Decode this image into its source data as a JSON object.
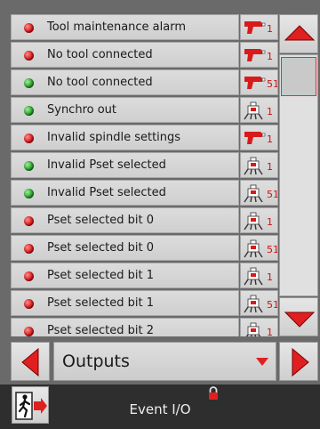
{
  "list": {
    "items": [
      {
        "label": "Tool maintenance alarm",
        "led": "red",
        "icon": "spindle-icon",
        "num": "1"
      },
      {
        "label": "No tool connected",
        "led": "red",
        "icon": "spindle-icon",
        "num": "1"
      },
      {
        "label": "No tool connected",
        "led": "green",
        "icon": "spindle-icon",
        "num": "51"
      },
      {
        "label": "Synchro out",
        "led": "green",
        "icon": "controller-icon",
        "num": "1"
      },
      {
        "label": "Invalid spindle settings",
        "led": "red",
        "icon": "spindle-icon",
        "num": "1"
      },
      {
        "label": "Invalid Pset selected",
        "led": "green",
        "icon": "controller-icon",
        "num": "1"
      },
      {
        "label": "Invalid Pset selected",
        "led": "green",
        "icon": "controller-icon",
        "num": "51"
      },
      {
        "label": "Pset selected bit 0",
        "led": "red",
        "icon": "controller-icon",
        "num": "1"
      },
      {
        "label": "Pset selected bit 0",
        "led": "red",
        "icon": "controller-icon",
        "num": "51"
      },
      {
        "label": "Pset selected bit 1",
        "led": "red",
        "icon": "controller-icon",
        "num": "1"
      },
      {
        "label": "Pset selected bit 1",
        "led": "red",
        "icon": "controller-icon",
        "num": "51"
      },
      {
        "label": "Pset selected bit 2",
        "led": "red",
        "icon": "controller-icon",
        "num": "1"
      }
    ]
  },
  "selector": {
    "value": "Outputs"
  },
  "footer": {
    "title": "Event I/O"
  },
  "colors": {
    "led_red": "#d81c1c",
    "led_green": "#2aa12a",
    "accent_red": "#e02020",
    "footer_bg": "#2e2e2e"
  }
}
